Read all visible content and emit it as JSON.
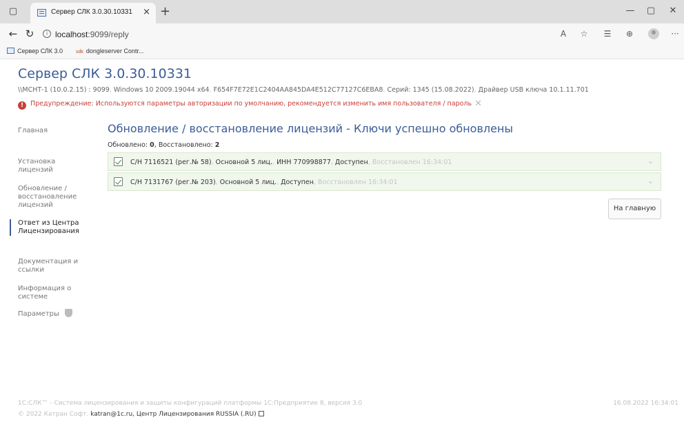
{
  "browser": {
    "tab_title": "Сервер СЛК 3.0.30.10331",
    "address_host": "localhost",
    "address_path": ":9099/reply",
    "bookmarks": [
      "Сервер СЛК 3.0",
      "dongleserver Contr..."
    ],
    "bookmark_icon_text": "sdk"
  },
  "header": {
    "title": "Сервер СЛК 3.0.30.10331",
    "info": [
      "\\\\МСНТ-1 (10.0.2.15) : 9099",
      "Windows 10 2009.19044 x64",
      "F654F7E72E1C2404AA845DA4E512C77127C6EBA8",
      "Серий: 1345 (15.08.2022)",
      "Драйвер USB ключа 10.1.11.701"
    ],
    "warning_label": "Предупреждение:",
    "warning_text": "Используются параметры авторизации по умолчанию, рекомендуется изменить имя пользователя / пароль"
  },
  "nav": {
    "items": [
      "Главная",
      "Установка лицензий",
      "Обновление / восстановление лицензий",
      "Ответ из Центра Лицензирования",
      "Документация и ссылки",
      "Информация о системе",
      "Параметры"
    ],
    "active_index": 3
  },
  "content": {
    "title": "Обновление / восстановление лицензий - Ключи успешно обновлены",
    "updated_label": "Обновлено:",
    "updated_count": "0",
    "restored_label": "Восстановлено:",
    "restored_count": "2",
    "rows": [
      {
        "serial": "С/Н 7116521 (рег.№ 58)",
        "type": "Основной 5 лиц.",
        "inn": "ИНН 770998877",
        "status": "Доступен",
        "restored": "Восстановлен 16:34:01"
      },
      {
        "serial": "С/Н 7131767 (рег.№ 203)",
        "type": "Основной 5 лиц.",
        "status": "Доступен",
        "restored": "Восстановлен 16:34:01"
      }
    ],
    "home_button": "На главную"
  },
  "footer": {
    "line1": "1С:СЛК™ - Система лицензирования и защиты конфигураций платформы 1С:Предприятие 8, версия 3.0",
    "date": "16.08.2022 16:34:01",
    "copyright": "© 2022 Катран Софт.",
    "email": "katran@1c.ru",
    "link": "Центр Лицензирования RUSSIA (.RU)"
  }
}
